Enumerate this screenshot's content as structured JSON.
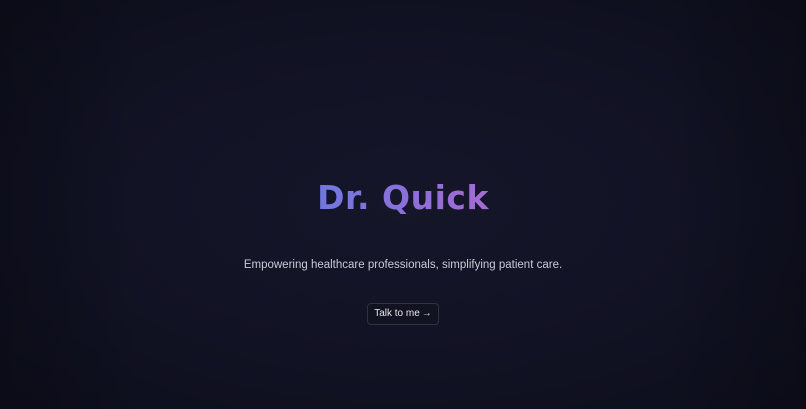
{
  "hero": {
    "title": "Dr. Quick",
    "subtitle": "Empowering healthcare professionals, simplifying patient care.",
    "cta_label": "Talk to me",
    "cta_icon": "arrow-right-icon",
    "cta_arrow": "→"
  },
  "colors": {
    "background": "#121325",
    "title_gradient_start": "#6f79dd",
    "title_gradient_end": "#a56bd3",
    "subtitle": "#c8cad6",
    "button_border": "#2f3242"
  }
}
